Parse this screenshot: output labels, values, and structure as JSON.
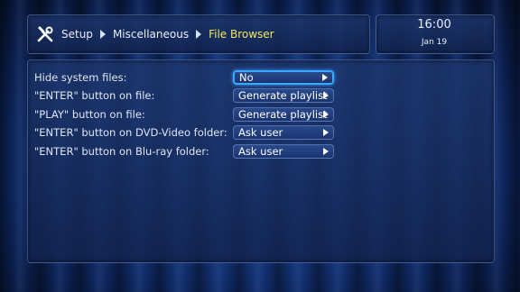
{
  "breadcrumb": {
    "icon": "tools-icon",
    "items": [
      "Setup",
      "Miscellaneous",
      "File Browser"
    ]
  },
  "clock": {
    "time": "16:00",
    "date": "Jan 19"
  },
  "settings": [
    {
      "label": "Hide system files:",
      "value": "No",
      "selected": true
    },
    {
      "label": "\"ENTER\" button on file:",
      "value": "Generate playlist",
      "selected": false
    },
    {
      "label": "\"PLAY\" button on file:",
      "value": "Generate playlist",
      "selected": false
    },
    {
      "label": "\"ENTER\" button on DVD-Video folder:",
      "value": "Ask user",
      "selected": false
    },
    {
      "label": "\"ENTER\" button on Blu-ray folder:",
      "value": "Ask user",
      "selected": false
    }
  ],
  "colors": {
    "accent": "#39a8ff",
    "current_crumb": "#f4e75a"
  }
}
